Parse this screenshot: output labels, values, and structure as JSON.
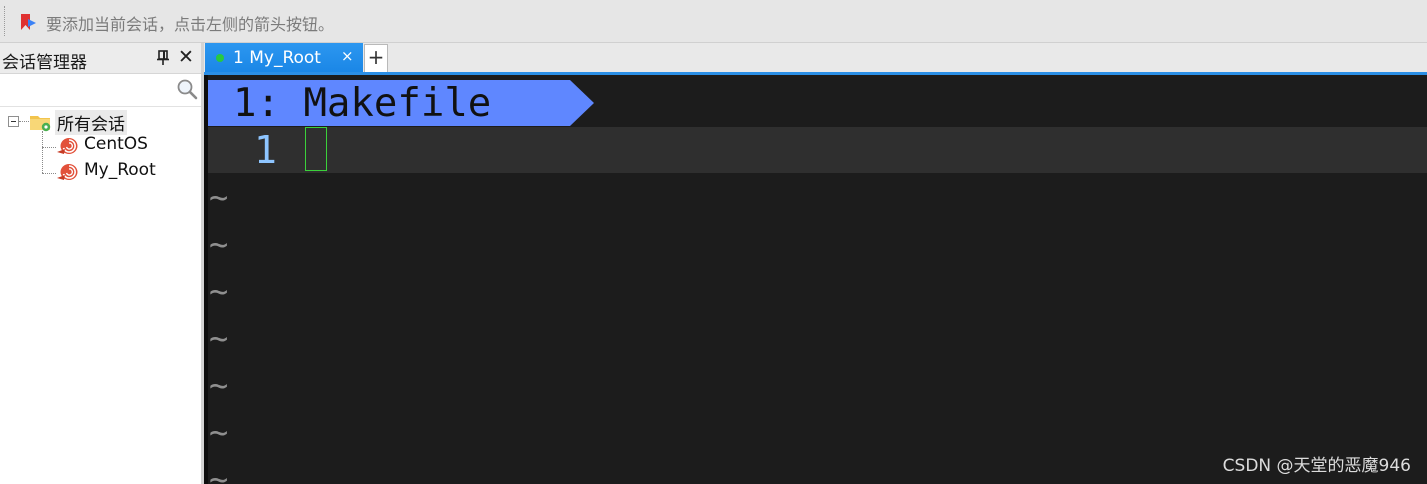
{
  "hint_bar": {
    "icon": "bookmark-arrow-icon",
    "text": "要添加当前会话，点击左侧的箭头按钮。"
  },
  "session_panel": {
    "title": "会话管理器",
    "pin_icon": "pin-icon",
    "close_glyph": "✕",
    "search": {
      "value": "",
      "placeholder": "",
      "icon": "search-icon"
    },
    "tree": {
      "root": {
        "label": "所有会话",
        "icon": "folder-icon",
        "expanded": true
      },
      "sessions": [
        {
          "label": "CentOS",
          "icon": "session-icon"
        },
        {
          "label": "My_Root",
          "icon": "session-icon"
        }
      ]
    }
  },
  "tabs": {
    "items": [
      {
        "label": "1 My_Root",
        "status_color": "#28c940",
        "active": true,
        "close_glyph": "×"
      }
    ],
    "add_glyph": "+"
  },
  "terminal": {
    "buffer_label": "1: Makefile",
    "buffer_color": "#5f87ff",
    "line_number": "1",
    "tilde": "~",
    "tilde_count": 7
  },
  "watermark": "CSDN @天堂的恶魔946"
}
